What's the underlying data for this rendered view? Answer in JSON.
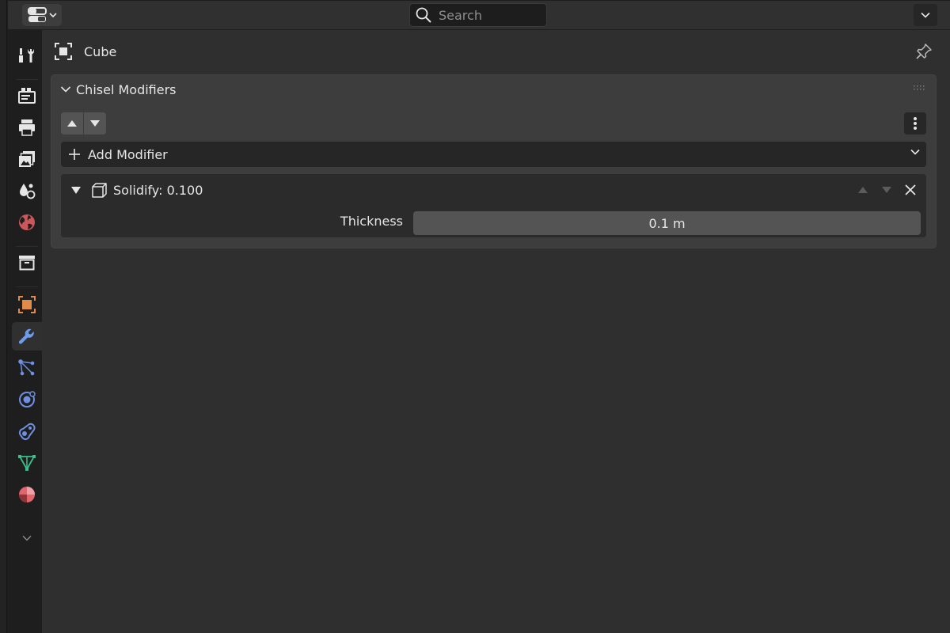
{
  "header": {
    "search_placeholder": "Search"
  },
  "object": {
    "name": "Cube"
  },
  "panel": {
    "title": "Chisel Modifiers",
    "add_modifier_label": "Add Modifier"
  },
  "modifier": {
    "title": "Solidify: 0.100",
    "thickness_label": "Thickness",
    "thickness_value": "0.1 m"
  },
  "tabs": [
    {
      "name": "tool-tab",
      "icon": "tool-icon"
    },
    {
      "name": "render-tab",
      "icon": "render-icon"
    },
    {
      "name": "output-tab",
      "icon": "output-icon"
    },
    {
      "name": "view-layer-tab",
      "icon": "view-layer-icon"
    },
    {
      "name": "scene-tab",
      "icon": "scene-icon"
    },
    {
      "name": "world-tab",
      "icon": "world-icon"
    },
    {
      "name": "collection-tab",
      "icon": "collection-icon"
    },
    {
      "name": "object-tab",
      "icon": "object-icon"
    },
    {
      "name": "modifiers-tab",
      "icon": "wrench-icon",
      "active": true
    },
    {
      "name": "particles-tab",
      "icon": "particles-icon"
    },
    {
      "name": "physics-tab",
      "icon": "physics-icon"
    },
    {
      "name": "constraints-tab",
      "icon": "constraints-icon"
    },
    {
      "name": "data-tab",
      "icon": "mesh-data-icon"
    },
    {
      "name": "material-tab",
      "icon": "material-icon"
    }
  ],
  "colors": {
    "accent": "#4772b3",
    "object_orange": "#e08b4a",
    "data_green": "#3bbf8d",
    "material_red": "#e0666c",
    "physics_blue": "#6f8fe0"
  }
}
